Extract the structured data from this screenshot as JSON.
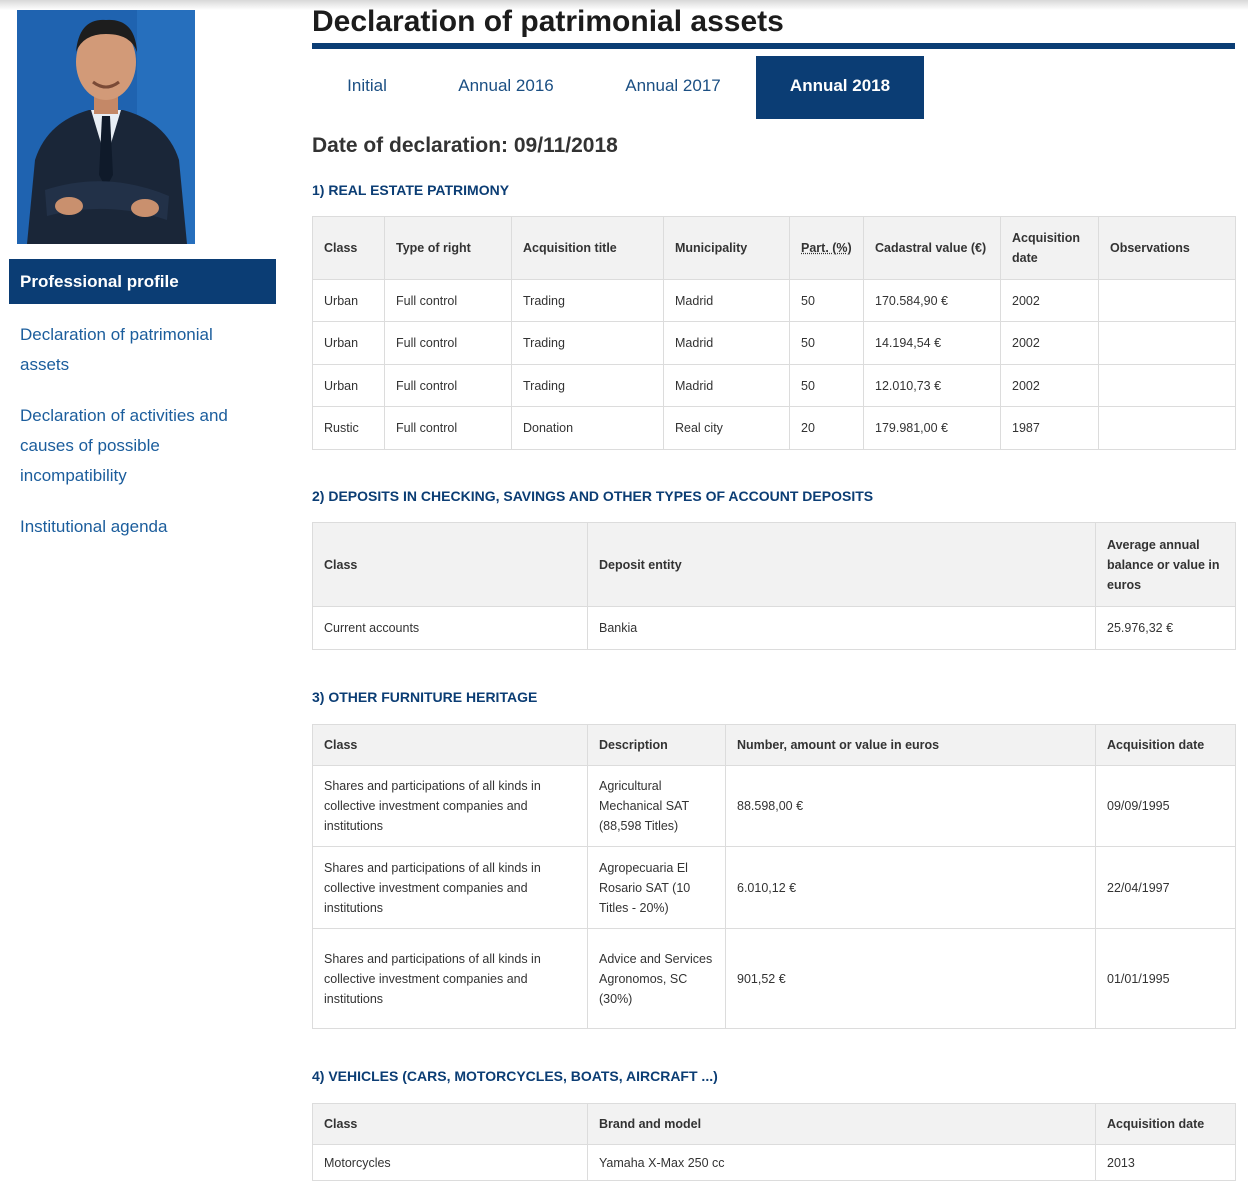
{
  "sidebar": {
    "photo_alt": "profile photo",
    "active_item": "Professional profile",
    "items": [
      {
        "label": "Declaration of patrimonial assets"
      },
      {
        "label": "Declaration of activities and causes of possible incompatibility"
      },
      {
        "label": "Institutional agenda"
      }
    ]
  },
  "page": {
    "title": "Declaration of patrimonial assets",
    "tabs": [
      {
        "label": "Initial"
      },
      {
        "label": "Annual 2016"
      },
      {
        "label": "Annual 2017"
      },
      {
        "label": "Annual 2018"
      }
    ],
    "active_tab": "Annual 2018",
    "declaration_date": "Date of declaration: 09/11/2018"
  },
  "real_estate": {
    "heading": "1) REAL ESTATE PATRIMONY",
    "headers": [
      "Class",
      "Type of right",
      "Acquisition title",
      "Municipality",
      "Part. (%)",
      "Cadastral value (€)",
      "Acquisition date",
      "Observations"
    ],
    "rows": [
      [
        "Urban",
        "Full control",
        "Trading",
        "Madrid",
        "50",
        "170.584,90 €",
        "2002",
        ""
      ],
      [
        "Urban",
        "Full control",
        "Trading",
        "Madrid",
        "50",
        "14.194,54 €",
        "2002",
        ""
      ],
      [
        "Urban",
        "Full control",
        "Trading",
        "Madrid",
        "50",
        "12.010,73 €",
        "2002",
        ""
      ],
      [
        "Rustic",
        "Full control",
        "Donation",
        "Real city",
        "20",
        "179.981,00 €",
        "1987",
        ""
      ]
    ]
  },
  "deposits": {
    "heading": "2) DEPOSITS IN CHECKING, SAVINGS AND OTHER TYPES OF ACCOUNT DEPOSITS",
    "headers": [
      "Class",
      "Deposit entity",
      "Average annual balance or value in euros"
    ],
    "rows": [
      [
        "Current accounts",
        "Bankia",
        "25.976,32 €"
      ]
    ]
  },
  "furniture": {
    "heading": "3) OTHER FURNITURE HERITAGE",
    "headers": [
      "Class",
      "Description",
      "Number, amount or value in euros",
      "Acquisition date"
    ],
    "rows": [
      [
        "Shares and participations of all kinds in collective investment companies and institutions",
        "Agricultural Mechanical SAT (88,598 Titles)",
        "88.598,00 €",
        "09/09/1995"
      ],
      [
        "Shares and participations of all kinds in collective investment companies and institutions",
        "Agropecuaria El Rosario SAT (10 Titles - 20%)",
        "6.010,12 €",
        "22/04/1997"
      ],
      [
        "Shares and participations of all kinds in collective investment companies and institutions",
        "Advice and Services Agronomos, SC (30%)",
        "901,52 €",
        "01/01/1995"
      ]
    ]
  },
  "vehicles": {
    "heading": "4) VEHICLES (CARS, MOTORCYCLES, BOATS, AIRCRAFT ...)",
    "headers": [
      "Class",
      "Brand and model",
      "Acquisition date"
    ],
    "rows": [
      [
        "Motorcycles",
        "Yamaha X-Max 250 cc",
        "2013"
      ]
    ]
  }
}
